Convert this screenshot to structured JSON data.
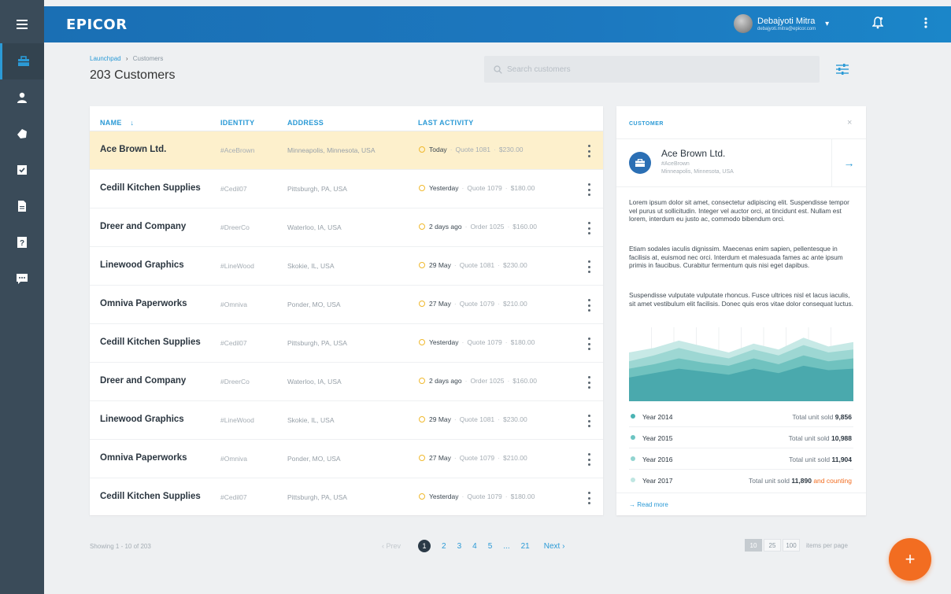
{
  "app": {
    "logo": "EPICOR"
  },
  "user": {
    "name": "Debajyoti Mitra",
    "email": "debajyoti.mitra@epicor.com"
  },
  "breadcrumb": {
    "root": "Launchpad",
    "separator": "›",
    "current": "Customers"
  },
  "page": {
    "title": "203 Customers"
  },
  "search": {
    "placeholder": "Search customers"
  },
  "table": {
    "columns": {
      "name": "NAME",
      "sort_icon": "↓",
      "identity": "IDENTITY",
      "address": "ADDRESS",
      "activity": "LAST ACTIVITY"
    },
    "rows": [
      {
        "name": "Ace Brown Ltd.",
        "identity": "#AceBrown",
        "address": "Minneapolis, Minnesota, USA",
        "when": "Today",
        "doc": "Quote 1081",
        "amount": "$230.00"
      },
      {
        "name": "Cedill Kitchen Supplies",
        "identity": "#Cedil07",
        "address": "Pittsburgh, PA, USA",
        "when": "Yesterday",
        "doc": "Quote 1079",
        "amount": "$180.00"
      },
      {
        "name": "Dreer and Company",
        "identity": "#DreerCo",
        "address": "Waterloo, IA, USA",
        "when": "2 days ago",
        "doc": "Order 1025",
        "amount": "$160.00"
      },
      {
        "name": "Linewood Graphics",
        "identity": "#LineWood",
        "address": "Skokie, IL, USA",
        "when": "29 May",
        "doc": "Quote 1081",
        "amount": "$230.00"
      },
      {
        "name": "Omniva Paperworks",
        "identity": "#Omniva",
        "address": "Ponder, MO, USA",
        "when": "27 May",
        "doc": "Quote 1079",
        "amount": "$210.00"
      },
      {
        "name": "Cedill Kitchen Supplies",
        "identity": "#Cedil07",
        "address": "Pittsburgh, PA, USA",
        "when": "Yesterday",
        "doc": "Quote 1079",
        "amount": "$180.00"
      },
      {
        "name": "Dreer and Company",
        "identity": "#DreerCo",
        "address": "Waterloo, IA, USA",
        "when": "2 days ago",
        "doc": "Order 1025",
        "amount": "$160.00"
      },
      {
        "name": "Linewood Graphics",
        "identity": "#LineWood",
        "address": "Skokie, IL, USA",
        "when": "29 May",
        "doc": "Quote 1081",
        "amount": "$230.00"
      },
      {
        "name": "Omniva Paperworks",
        "identity": "#Omniva",
        "address": "Ponder, MO, USA",
        "when": "27 May",
        "doc": "Quote 1079",
        "amount": "$210.00"
      },
      {
        "name": "Cedill Kitchen Supplies",
        "identity": "#Cedil07",
        "address": "Pittsburgh, PA, USA",
        "when": "Yesterday",
        "doc": "Quote 1079",
        "amount": "$180.00"
      }
    ]
  },
  "detail": {
    "label": "CUSTOMER",
    "close": "×",
    "name": "Ace Brown Ltd.",
    "handle": "#AceBrown",
    "location": "Minneapolis, Minnesota, USA",
    "paragraphs": [
      "Lorem ipsum dolor sit amet, consectetur adipiscing elit. Suspendisse tempor vel purus ut sollicitudin. Integer vel auctor orci, at tincidunt est. Nullam est lorem, interdum eu justo ac, commodo bibendum orci.",
      "Etiam sodales iaculis dignissim. Maecenas enim sapien, pellentesque in facilisis at, euismod nec orci. Interdum et malesuada fames ac ante ipsum primis in faucibus. Curabitur fermentum quis nisi eget dapibus.",
      "Suspendisse vulputate vulputate rhoncus. Fusce ultrices nisl et lacus iaculis, sit amet vestibulum elit facilisis. Donec quis eros vitae dolor consequat luctus."
    ],
    "legend": [
      {
        "year": "Year 2014",
        "prefix": "Total unit sold",
        "value": "9,856",
        "extra": "",
        "color": "#4ab3b3"
      },
      {
        "year": "Year 2015",
        "prefix": "Total unit sold",
        "value": "10,988",
        "extra": "",
        "color": "#6cc4c2"
      },
      {
        "year": "Year 2016",
        "prefix": "Total unit sold",
        "value": "11,904",
        "extra": "",
        "color": "#92d4d0"
      },
      {
        "year": "Year 2017",
        "prefix": "Total unit sold",
        "value": "11,890",
        "extra": "and counting",
        "color": "#bfe6e2"
      }
    ],
    "read_more": "→ Read more"
  },
  "chart_data": {
    "type": "area",
    "series": [
      {
        "name": "Year 2017",
        "values": [
          66,
          72,
          82,
          74,
          66,
          78,
          70,
          86,
          74,
          80
        ]
      },
      {
        "name": "Year 2016",
        "values": [
          54,
          62,
          72,
          64,
          58,
          70,
          62,
          76,
          66,
          70
        ]
      },
      {
        "name": "Year 2015",
        "values": [
          44,
          50,
          58,
          52,
          48,
          58,
          50,
          62,
          54,
          58
        ]
      },
      {
        "name": "Year 2014",
        "values": [
          32,
          38,
          44,
          40,
          36,
          44,
          38,
          48,
          42,
          44
        ]
      }
    ],
    "ylim": [
      0,
      100
    ],
    "colors": [
      "#c7e9e6",
      "#9dd7d3",
      "#70c2bf",
      "#4aa9ad"
    ]
  },
  "footer": {
    "showing": "Showing 1 - 10 of 203",
    "prev": "‹ Prev",
    "pages": [
      "1",
      "2",
      "3",
      "4",
      "5",
      "...",
      "21"
    ],
    "next": "Next ›",
    "perpage_options": [
      "10",
      "25",
      "100"
    ],
    "perpage_label": "items per page"
  },
  "fab": {
    "label": "+"
  }
}
